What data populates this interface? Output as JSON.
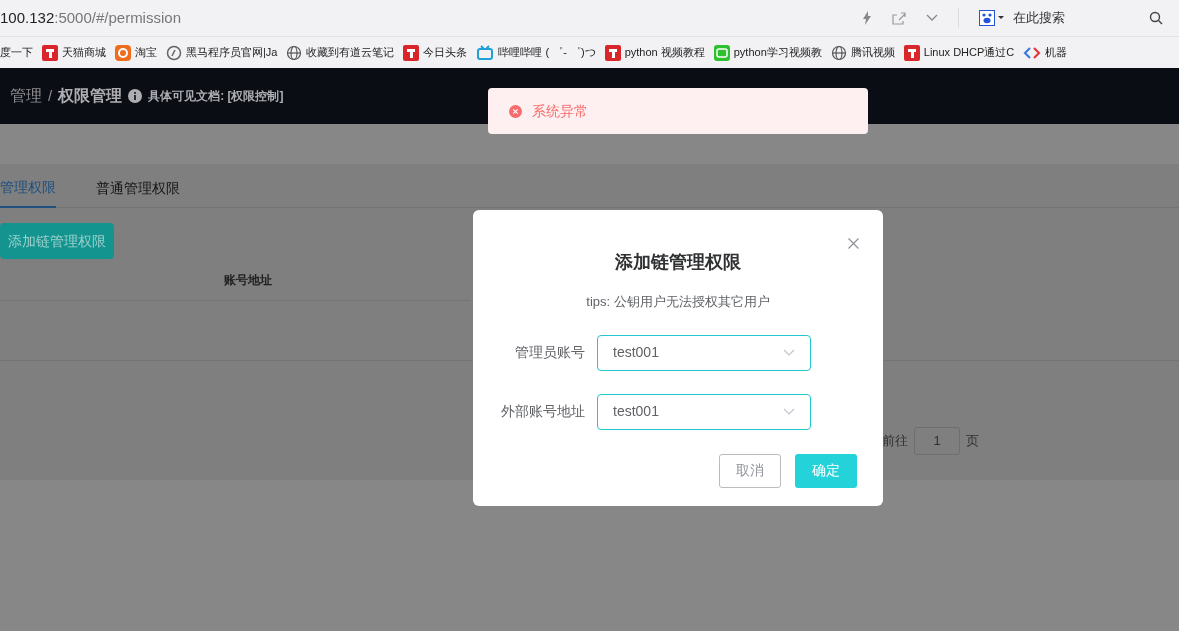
{
  "browser": {
    "url_host": "100.132",
    "url_path": ":5000/#/permission",
    "search_placeholder": "在此搜索",
    "bookmarks": [
      {
        "label": "度一下",
        "kind": "plain"
      },
      {
        "label": "天猫商城",
        "kind": "red"
      },
      {
        "label": "淘宝",
        "kind": "orange"
      },
      {
        "label": "黑马程序员官网|Ja",
        "kind": "circle"
      },
      {
        "label": "收藏到有道云笔记",
        "kind": "globe"
      },
      {
        "label": "今日头条",
        "kind": "red"
      },
      {
        "label": "哔哩哔哩 ( ゜- ゜)つ",
        "kind": "tv"
      },
      {
        "label": "python 视频教程",
        "kind": "red"
      },
      {
        "label": "python学习视频教",
        "kind": "green"
      },
      {
        "label": "腾讯视频",
        "kind": "globe"
      },
      {
        "label": "Linux DHCP通过C",
        "kind": "red"
      },
      {
        "label": "机器",
        "kind": "code"
      }
    ]
  },
  "header": {
    "breadcrumb_parent": "管理",
    "separator": "/",
    "breadcrumb_current": "权限管理",
    "doc_hint": "具体可见文档: [权限控制]"
  },
  "tabs": [
    {
      "label": "管理权限",
      "selected": true
    },
    {
      "label": "普通管理权限",
      "selected": false
    }
  ],
  "add_button": "添加链管理权限",
  "table": {
    "columns": [
      "账号地址"
    ]
  },
  "pagination": {
    "goto": "前往",
    "page": "1",
    "suffix": "页"
  },
  "toast": {
    "message": "系统异常"
  },
  "dialog": {
    "title": "添加链管理权限",
    "tips": "tips: 公钥用户无法授权其它用户",
    "fields": [
      {
        "label": "管理员账号",
        "value": "test001"
      },
      {
        "label": "外部账号地址",
        "value": "test001"
      }
    ],
    "cancel": "取消",
    "confirm": "确定"
  }
}
